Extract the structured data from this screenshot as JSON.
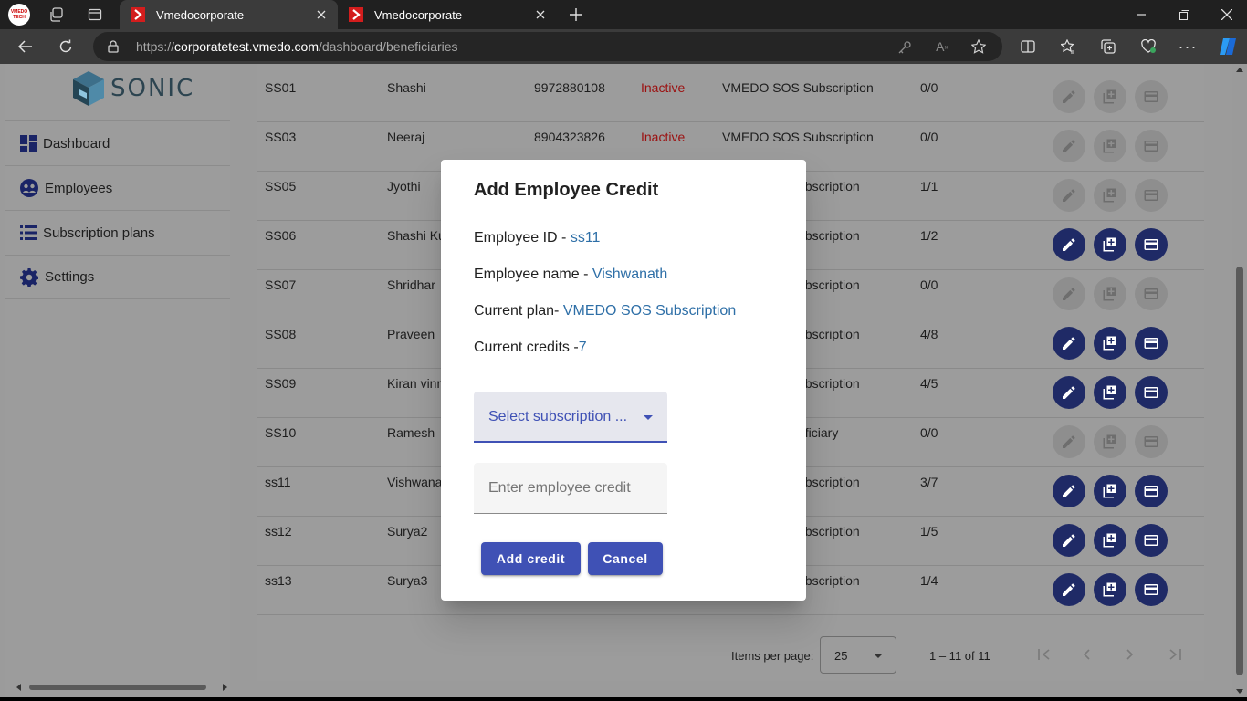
{
  "browser": {
    "tabs": [
      {
        "title": "Vmedocorporate",
        "active": true
      },
      {
        "title": "Vmedocorporate",
        "active": false
      }
    ],
    "profile_text": "VMEDO TECH",
    "url_prefix": "https://",
    "url_host": "corporatetest.vmedo.com",
    "url_path": "/dashboard/beneficiaries"
  },
  "sidebar": {
    "brand": "SONIC",
    "items": [
      {
        "label": "Dashboard",
        "icon": "dashboard-icon"
      },
      {
        "label": "Employees",
        "icon": "employees-icon"
      },
      {
        "label": "Subscription plans",
        "icon": "list-icon"
      },
      {
        "label": "Settings",
        "icon": "gear-icon"
      }
    ]
  },
  "table": {
    "rows": [
      {
        "id": "SS01",
        "name": "Shashi",
        "phone": "9972880108",
        "status": "Inactive",
        "plan": "VMEDO SOS Subscription",
        "credits": "0/0",
        "active": false
      },
      {
        "id": "SS03",
        "name": "Neeraj",
        "phone": "8904323826",
        "status": "Inactive",
        "plan": "VMEDO SOS Subscription",
        "credits": "0/0",
        "active": false
      },
      {
        "id": "SS05",
        "name": "Jyothi",
        "phone": "",
        "status": "",
        "plan": "ubscription",
        "credits": "1/1",
        "active": false
      },
      {
        "id": "SS06",
        "name": "Shashi Ku",
        "phone": "",
        "status": "",
        "plan": "ubscription",
        "credits": "1/2",
        "active": true
      },
      {
        "id": "SS07",
        "name": "Shridhar",
        "phone": "",
        "status": "",
        "plan": "ubscription",
        "credits": "0/0",
        "active": false
      },
      {
        "id": "SS08",
        "name": "Praveen",
        "phone": "",
        "status": "",
        "plan": "ubscription",
        "credits": "4/8",
        "active": true
      },
      {
        "id": "SS09",
        "name": "Kiran vinn",
        "phone": "",
        "status": "",
        "plan": "ubscription",
        "credits": "4/5",
        "active": true
      },
      {
        "id": "SS10",
        "name": "Ramesh",
        "phone": "",
        "status": "",
        "plan": "eficiary",
        "credits": "0/0",
        "active": false
      },
      {
        "id": "ss11",
        "name": "Vishwana",
        "phone": "",
        "status": "",
        "plan": "ubscription",
        "credits": "3/7",
        "active": true
      },
      {
        "id": "ss12",
        "name": "Surya2",
        "phone": "",
        "status": "",
        "plan": "ubscription",
        "credits": "1/5",
        "active": true
      },
      {
        "id": "ss13",
        "name": "Surya3",
        "phone": "",
        "status": "",
        "plan": "ubscription",
        "credits": "1/4",
        "active": true
      }
    ]
  },
  "paginator": {
    "label": "Items per page:",
    "page_size": "25",
    "range": "1 – 11 of 11"
  },
  "dialog": {
    "title": "Add Employee Credit",
    "employee_id_label": "Employee ID - ",
    "employee_id": "ss11",
    "employee_name_label": "Employee name - ",
    "employee_name": "Vishwanath",
    "current_plan_label": "Current plan- ",
    "current_plan": "VMEDO SOS Subscription",
    "current_credits_label": "Current credits -",
    "current_credits": "7",
    "select_placeholder": "Select subscription ...",
    "credit_placeholder": "Enter employee credit",
    "credit_value": "",
    "add_label": "Add credit",
    "cancel_label": "Cancel"
  },
  "colors": {
    "primary": "#3f51b5",
    "link_value": "#2e6fa7",
    "inactive": "#c62828",
    "tab_bar": "#202020",
    "toolbar": "#3b3b3b"
  }
}
